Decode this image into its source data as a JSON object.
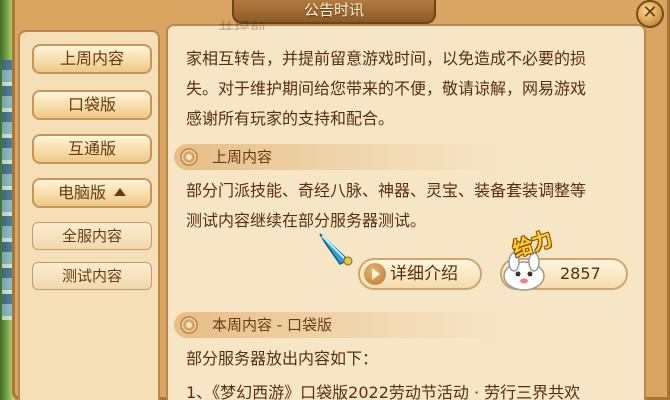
{
  "window": {
    "title": "公告时讯",
    "close_symbol": "✕"
  },
  "sidebar": {
    "items": [
      {
        "label": "上周内容"
      },
      {
        "label": "口袋版"
      },
      {
        "label": "互通版"
      },
      {
        "label": "电脑版"
      },
      {
        "label": "全服内容"
      },
      {
        "label": "测试内容"
      }
    ]
  },
  "content": {
    "partial_top_line": "……并提前……",
    "paragraph_1": [
      "家相互转告，并提前留意游戏时间，以免造成不必要的损",
      "失。对于维护期间给您带来的不便，敬请谅解，网易游戏",
      "感谢所有玩家的支持和配合。"
    ],
    "section_last_week": {
      "title": "上周内容",
      "lines": [
        "部分门派技能、奇经八脉、神器、灵宝、装备套装调整等",
        "测试内容继续在部分服务器测试。"
      ]
    },
    "detail_button": "详细介绍",
    "like": {
      "badge": "给力",
      "count": "2857"
    },
    "section_this_week": {
      "title": "本周内容 - 口袋版",
      "lines": [
        "部分服务器放出内容如下：",
        "1、《梦幻西游》口袋版2022劳动节活动 · 劳行三界共欢"
      ]
    }
  }
}
